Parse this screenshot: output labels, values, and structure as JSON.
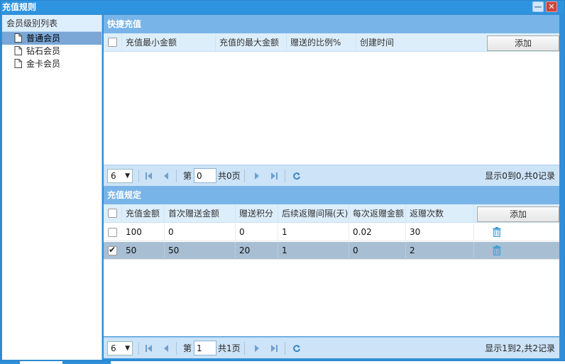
{
  "window": {
    "title": "充值规则"
  },
  "left": {
    "header": "会员级别列表",
    "items": [
      {
        "label": "普通会员",
        "selected": true
      },
      {
        "label": "钻石会员",
        "selected": false
      },
      {
        "label": "金卡会员",
        "selected": false
      }
    ]
  },
  "quick": {
    "title": "快捷充值",
    "columns": [
      "充值最小金额",
      "充值的最大金额",
      "赠送的比例%",
      "创建时间"
    ],
    "add_label": "添加",
    "pager": {
      "page_size": "6",
      "page_prefix": "第",
      "page_value": "0",
      "page_total": "共0页",
      "info": "显示0到0,共0记录"
    }
  },
  "rules": {
    "title": "充值规定",
    "columns": [
      "充值金额",
      "首次赠送金额",
      "赠送积分",
      "后续返赠间隔(天)",
      "每次返赠金额",
      "返赠次数"
    ],
    "add_label": "添加",
    "rows": [
      {
        "checked": false,
        "values": [
          "100",
          "0",
          "0",
          "1",
          "0.02",
          "30"
        ]
      },
      {
        "checked": true,
        "values": [
          "50",
          "50",
          "20",
          "1",
          "0",
          "2"
        ]
      }
    ],
    "pager": {
      "page_size": "6",
      "page_prefix": "第",
      "page_value": "1",
      "page_total": "共1页",
      "info": "显示1到2,共2记录"
    }
  },
  "colors": {
    "accent": "#2f8fd8",
    "panel_title": "#79b4e8",
    "header_bg": "#ddeefb",
    "selected_row": "#a7bed3",
    "icon_blue": "#2a7fc0"
  },
  "icons": [
    "minimize-icon",
    "close-icon",
    "document-icon",
    "trash-icon",
    "first-page-icon",
    "prev-page-icon",
    "next-page-icon",
    "last-page-icon",
    "refresh-icon"
  ]
}
